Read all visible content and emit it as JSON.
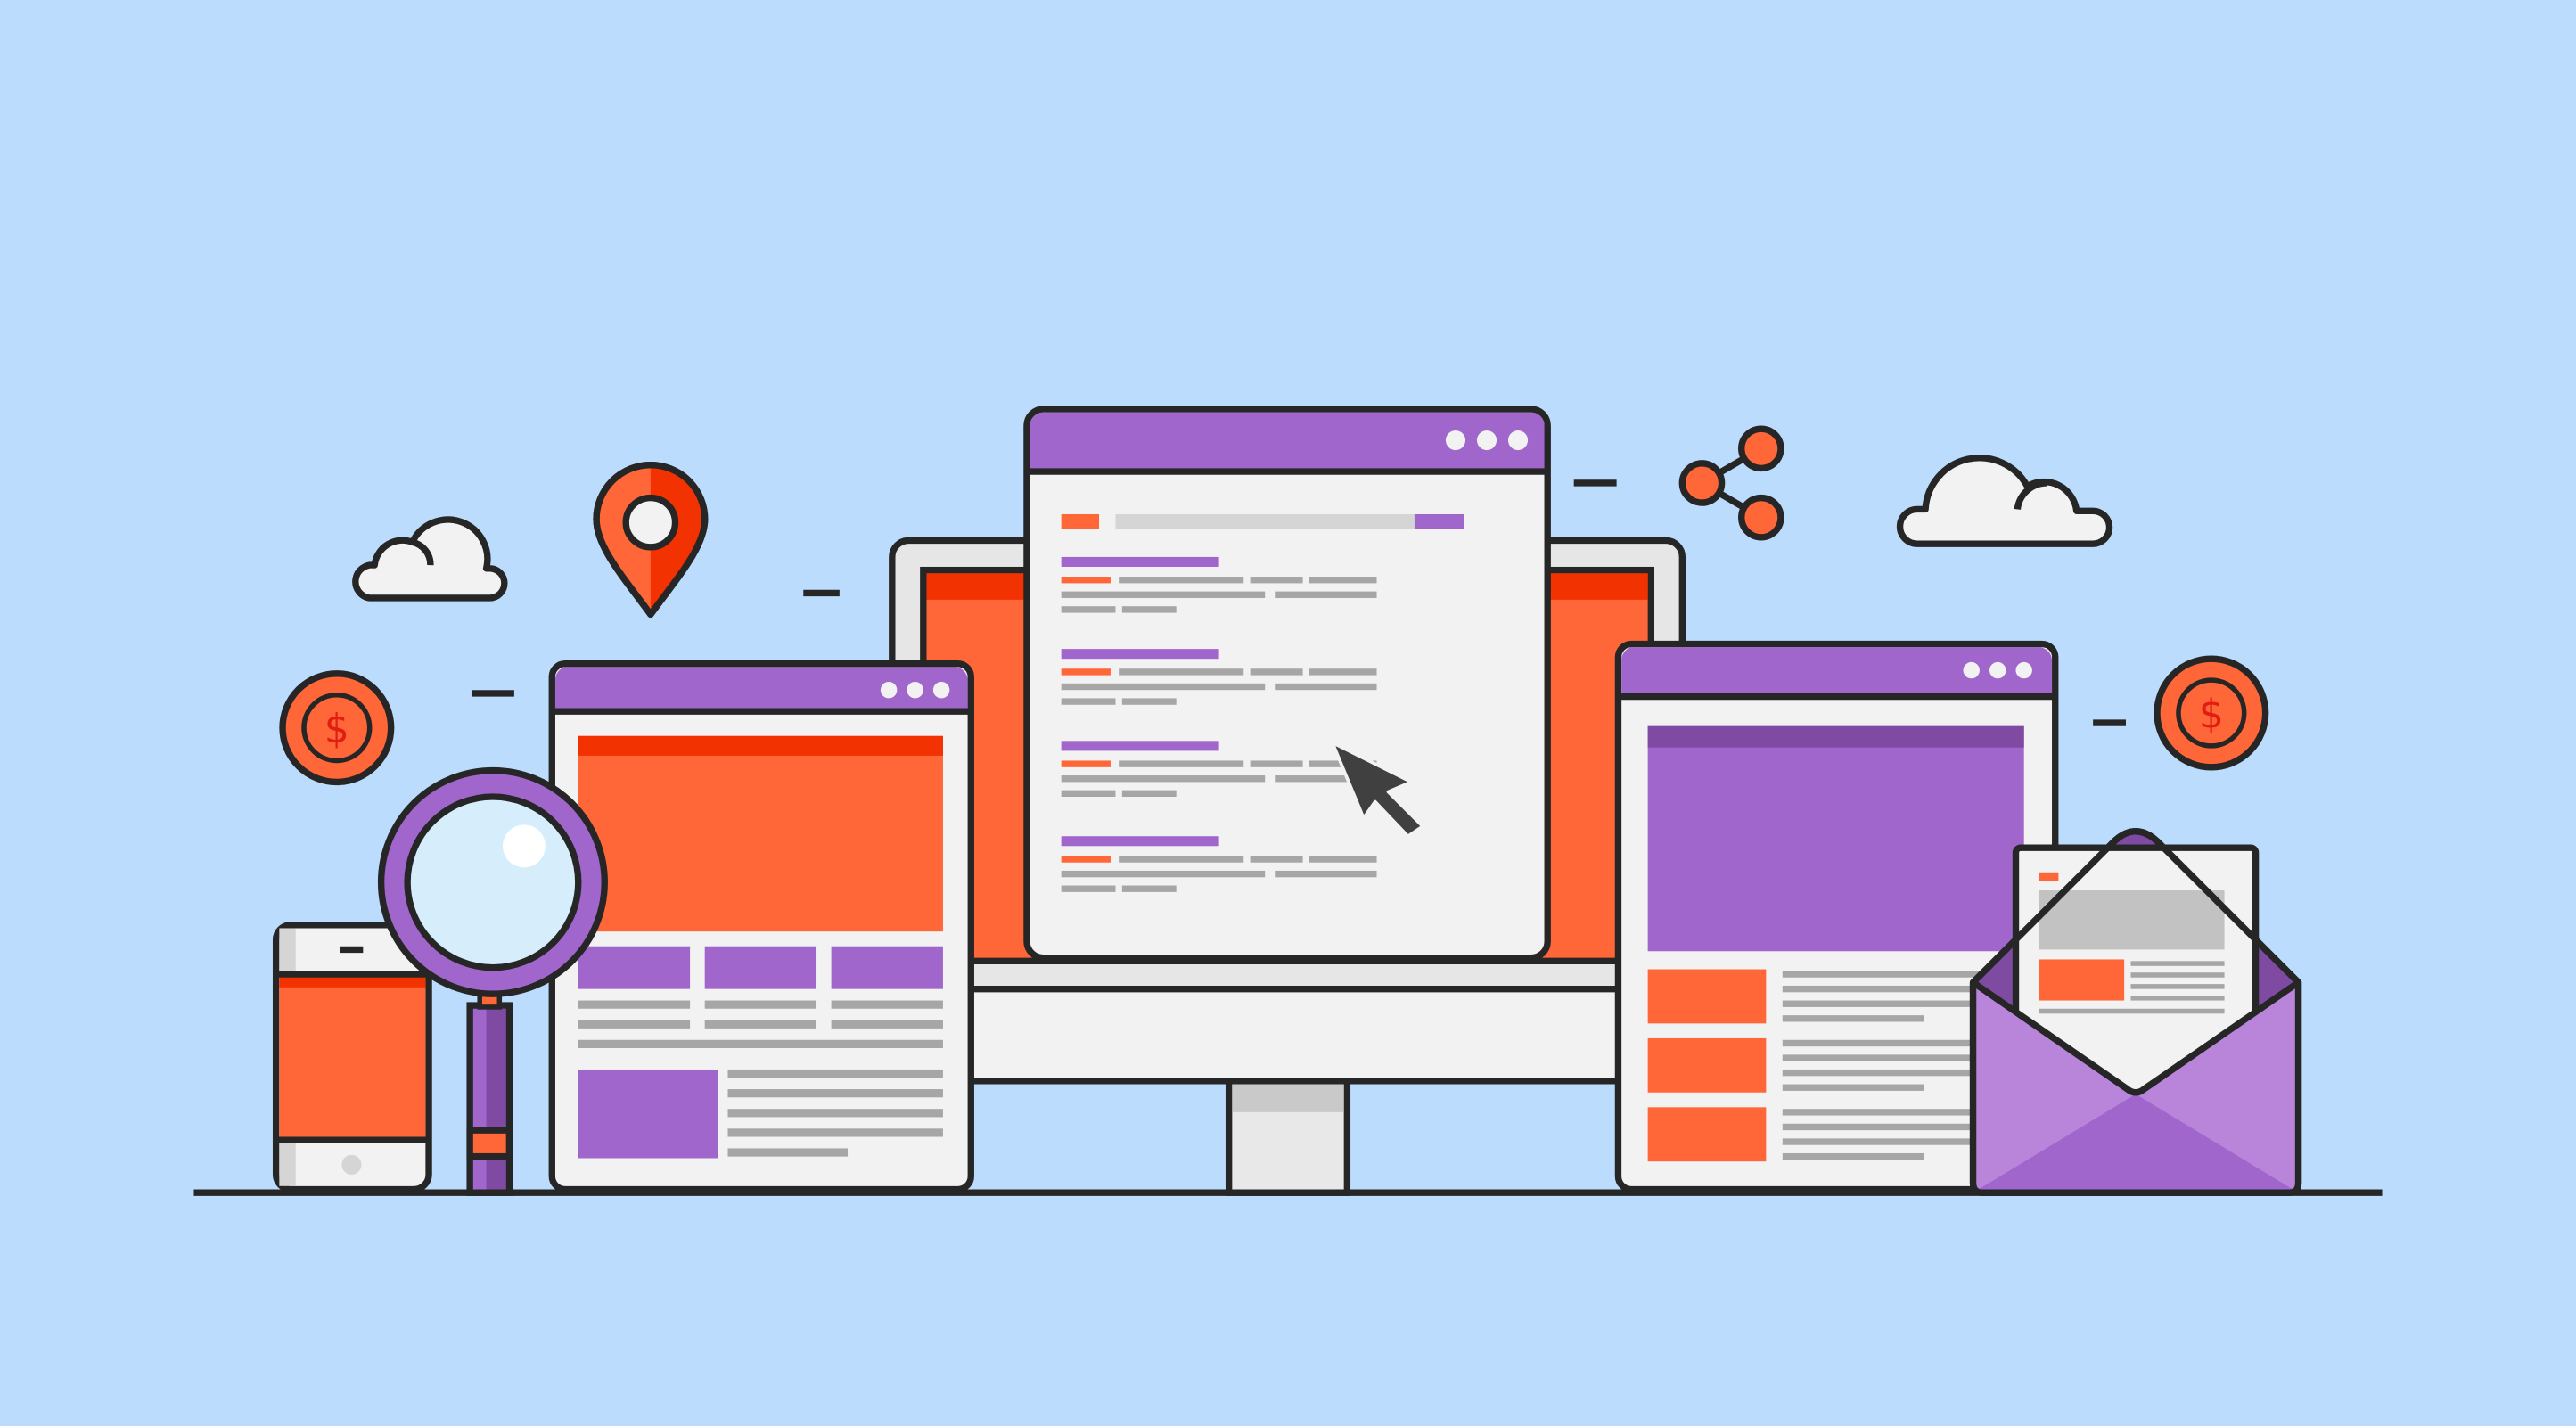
{
  "scene": {
    "description_free": true,
    "currency_symbol": "$"
  },
  "colors": {
    "background": "#bbdcfd",
    "outline": "#262626",
    "purple": "#a066cc",
    "purple_dark": "#7e4aa2",
    "purple_light": "#b985db",
    "orange": "#ff6638",
    "orange_dark": "#f23200",
    "panel": "#f2f2f2",
    "line_gray": "#a6a6a6",
    "light_gray": "#d5d5d5",
    "white": "#ffffff",
    "glass": "#d6edfc"
  },
  "icons": [
    "cloud-icon",
    "map-pin-icon",
    "share-icon",
    "coin-dollar-icon",
    "magnifier-icon",
    "cursor-icon",
    "envelope-icon",
    "smartphone-icon",
    "browser-window-icon"
  ]
}
